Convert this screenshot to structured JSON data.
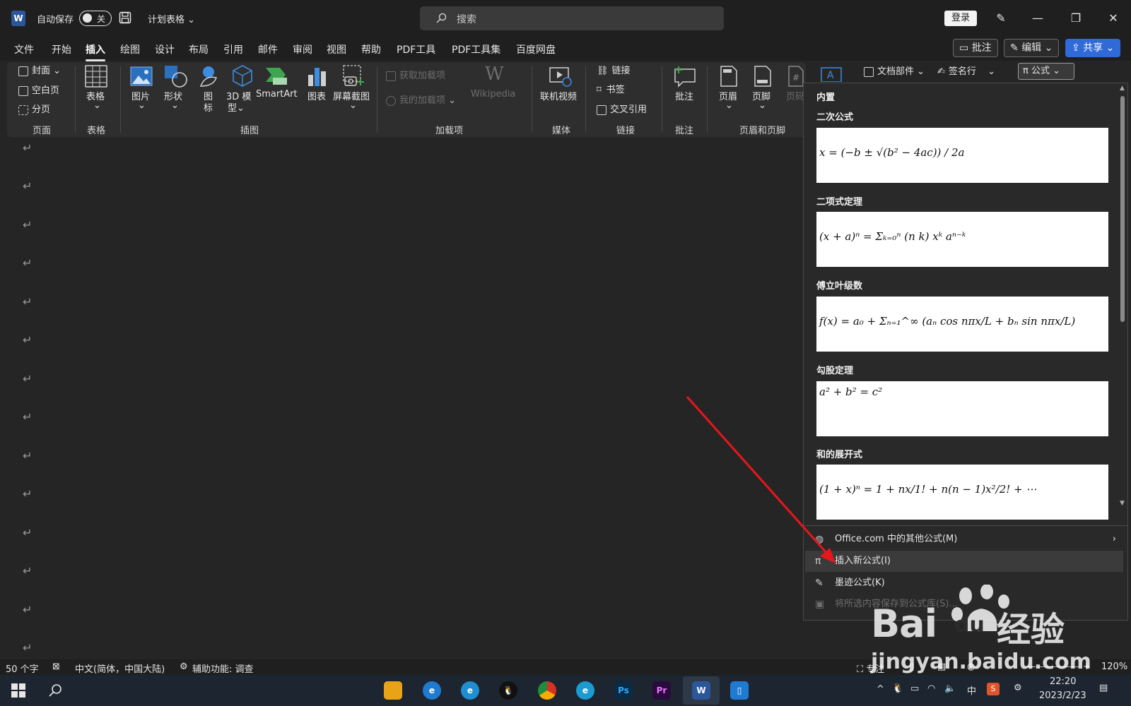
{
  "titlebar": {
    "app_logo": "W",
    "autosave_label": "自动保存",
    "autosave_state": "关",
    "doc_title": "计划表格",
    "search_placeholder": "搜索",
    "login_label": "登录"
  },
  "menu_tabs": [
    "文件",
    "开始",
    "插入",
    "绘图",
    "设计",
    "布局",
    "引用",
    "邮件",
    "审阅",
    "视图",
    "帮助",
    "PDF工具",
    "PDF工具集",
    "百度网盘"
  ],
  "active_tab": "插入",
  "right_actions": {
    "comment": "批注",
    "edit": "编辑",
    "share": "共享"
  },
  "ribbon": {
    "pages": {
      "cover": "封面",
      "blank": "空白页",
      "break": "分页",
      "group": "页面"
    },
    "tables": {
      "table": "表格",
      "group": "表格"
    },
    "illustrations": {
      "picture": "图片",
      "shape": "形状",
      "icon1": "图",
      "icon2": "标",
      "model1": "3D 模",
      "model2": "型",
      "smartart": "SmartArt",
      "chart": "图表",
      "screenshot": "屏幕截图",
      "group": "插图"
    },
    "addins": {
      "get": "获取加载项",
      "mine": "我的加载项",
      "wiki": "Wikipedia",
      "group": "加载项"
    },
    "media": {
      "video": "联机视频",
      "group": "媒体"
    },
    "links": {
      "link": "链接",
      "bookmark": "书签",
      "crossref": "交叉引用",
      "group": "链接"
    },
    "comments": {
      "comment": "批注",
      "group": "批注"
    },
    "header_footer": {
      "header": "页眉",
      "footer": "页脚",
      "pagenum": "页码",
      "group": "页眉和页脚"
    },
    "text": {
      "doc_parts": "文档部件",
      "signature": "签名行",
      "equation": "公式"
    }
  },
  "equation_panel": {
    "section": "内置",
    "items": [
      {
        "title": "二次公式",
        "formula": "x = (−b ± √(b² − 4ac)) / 2a"
      },
      {
        "title": "二项式定理",
        "formula": "(x + a)ⁿ = Σₖ₌₀ⁿ (n k) xᵏ aⁿ⁻ᵏ"
      },
      {
        "title": "傅立叶级数",
        "formula": "f(x) = a₀ + Σₙ₌₁^∞ (aₙ cos nπx/L + bₙ sin nπx/L)"
      },
      {
        "title": "勾股定理",
        "formula": "a² + b² = c²"
      },
      {
        "title": "和的展开式",
        "formula": "(1 + x)ⁿ = 1 + nx/1! + n(n − 1)x²/2! + ⋯"
      }
    ],
    "menu": [
      {
        "label": "Office.com 中的其他公式(M)",
        "icon": "globe-icon"
      },
      {
        "label": "插入新公式(I)",
        "icon": "pi-icon"
      },
      {
        "label": "墨迹公式(K)",
        "icon": "ink-equation-icon"
      },
      {
        "label": "将所选内容保存到公式库(S)...",
        "icon": "save-icon"
      }
    ]
  },
  "statusbar": {
    "word_count": "50 个字",
    "language": "中文(简体，中国大陆)",
    "accessibility": "辅助功能: 调查",
    "focus": "专注",
    "zoom": "120%"
  },
  "taskbar": {
    "time": "22:20",
    "date": "2023/2/23",
    "ime": "中"
  },
  "watermark": {
    "brand": "Bai",
    "brand2": "du",
    "cn": "经验",
    "url": "jingyan.baidu.com"
  },
  "colors": {
    "accent": "#2f6ad6",
    "arrow": "#e8161b",
    "word_blue": "#2b579a"
  }
}
